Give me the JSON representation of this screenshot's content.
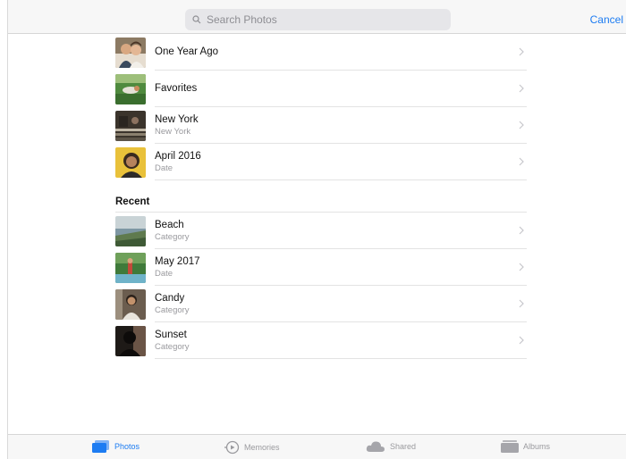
{
  "search": {
    "placeholder": "Search Photos"
  },
  "header": {
    "cancel_label": "Cancel"
  },
  "colors": {
    "accent": "#1d7cf2",
    "secondary_text": "#9a9a9e"
  },
  "suggestions": [
    {
      "title": "One Year Ago",
      "subtitle": "",
      "thumb": "people-photo"
    },
    {
      "title": "Favorites",
      "subtitle": "",
      "thumb": "grass-photo"
    },
    {
      "title": "New York",
      "subtitle": "New York",
      "thumb": "city-photo"
    },
    {
      "title": "April 2016",
      "subtitle": "Date",
      "thumb": "portrait-photo"
    }
  ],
  "recent": {
    "title": "Recent",
    "items": [
      {
        "title": "Beach",
        "subtitle": "Category",
        "thumb": "beach-photo"
      },
      {
        "title": "May 2017",
        "subtitle": "Date",
        "thumb": "garden-photo"
      },
      {
        "title": "Candy",
        "subtitle": "Category",
        "thumb": "candy-photo"
      },
      {
        "title": "Sunset",
        "subtitle": "Category",
        "thumb": "sunset-photo"
      }
    ]
  },
  "tabs": [
    {
      "label": "Photos",
      "icon": "photos-icon",
      "active": true
    },
    {
      "label": "Memories",
      "icon": "memories-icon",
      "active": false
    },
    {
      "label": "Shared",
      "icon": "cloud-icon",
      "active": false
    },
    {
      "label": "Albums",
      "icon": "albums-icon",
      "active": false
    }
  ]
}
